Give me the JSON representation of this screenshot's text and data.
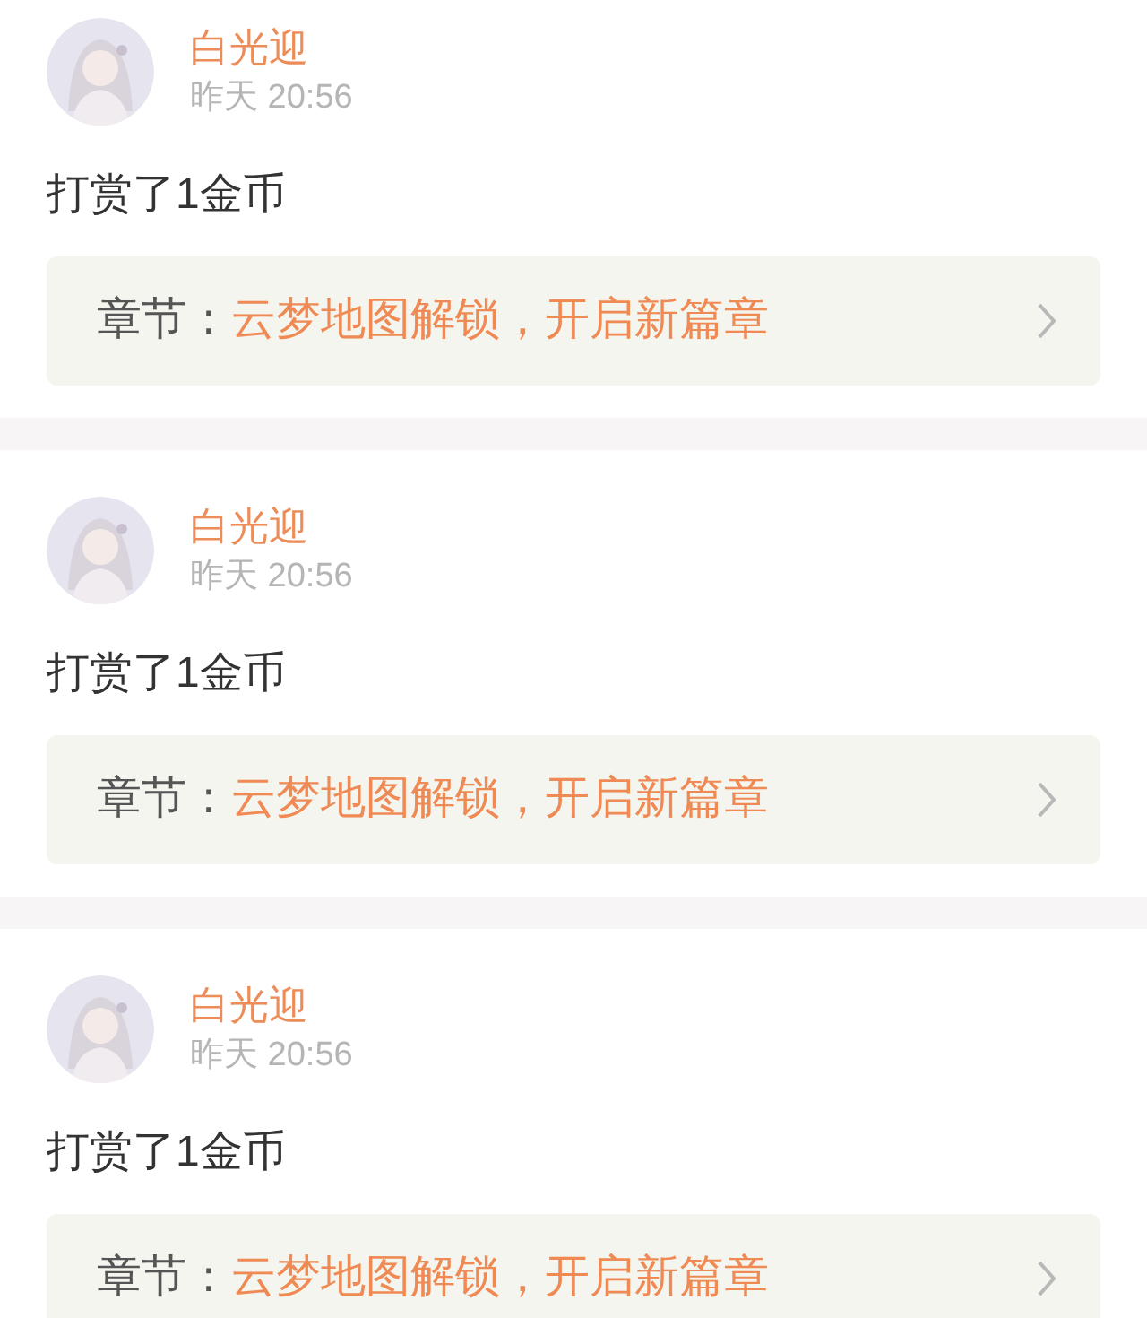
{
  "posts": [
    {
      "user": "白光迎",
      "time": "昨天 20:56",
      "message": "打赏了1金币",
      "chapter_label": "章节：",
      "chapter_title": "云梦地图解锁，开启新篇章"
    },
    {
      "user": "白光迎",
      "time": "昨天 20:56",
      "message": "打赏了1金币",
      "chapter_label": "章节：",
      "chapter_title": "云梦地图解锁，开启新篇章"
    },
    {
      "user": "白光迎",
      "time": "昨天 20:56",
      "message": "打赏了1金币",
      "chapter_label": "章节：",
      "chapter_title": "云梦地图解锁，开启新篇章"
    }
  ]
}
